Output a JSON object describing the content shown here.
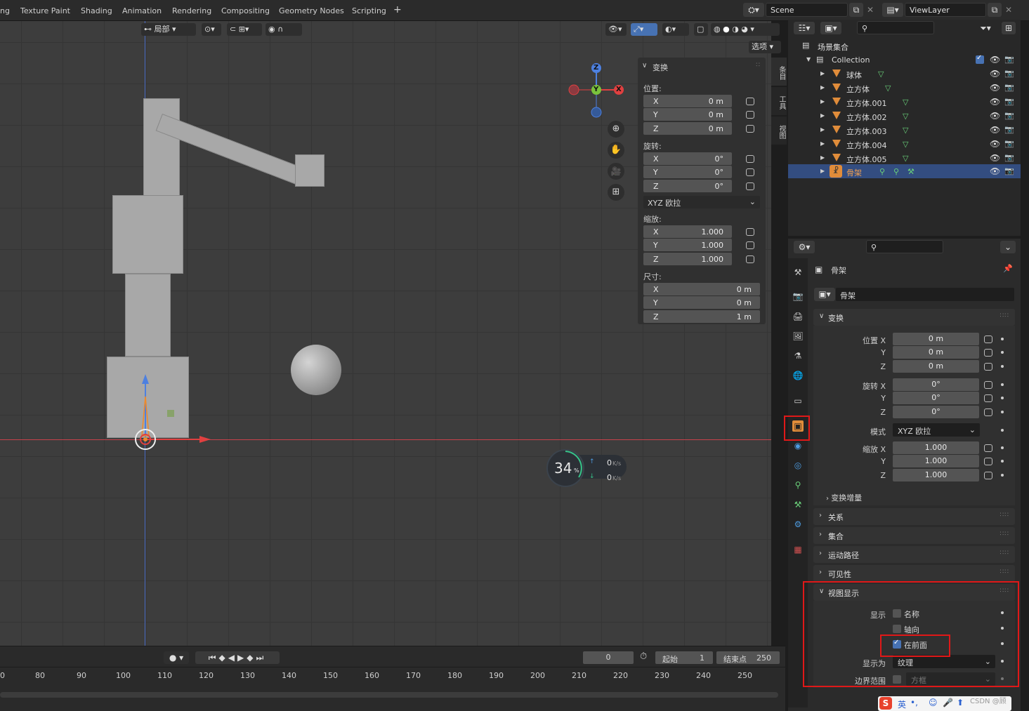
{
  "topbar": {
    "tabs": [
      "ng",
      "Texture Paint",
      "Shading",
      "Animation",
      "Rendering",
      "Compositing",
      "Geometry Nodes",
      "Scripting",
      "+"
    ],
    "scene": "Scene",
    "view_layer": "ViewLayer"
  },
  "viewport": {
    "transform_orientation": "局部",
    "options_label": "选项",
    "gizmo_axes": [
      "Z",
      "Y",
      "X"
    ],
    "side_tabs": [
      "条目",
      "工具",
      "视图"
    ],
    "npanel": {
      "title": "变换",
      "location_label": "位置:",
      "location": [
        {
          "axis": "X",
          "value": "0 m"
        },
        {
          "axis": "Y",
          "value": "0 m"
        },
        {
          "axis": "Z",
          "value": "0 m"
        }
      ],
      "rotation_label": "旋转:",
      "rotation": [
        {
          "axis": "X",
          "value": "0°"
        },
        {
          "axis": "Y",
          "value": "0°"
        },
        {
          "axis": "Z",
          "value": "0°"
        }
      ],
      "rotation_mode": "XYZ 欧拉",
      "scale_label": "缩放:",
      "scale": [
        {
          "axis": "X",
          "value": "1.000"
        },
        {
          "axis": "Y",
          "value": "1.000"
        },
        {
          "axis": "Z",
          "value": "1.000"
        }
      ],
      "dimensions_label": "尺寸:",
      "dimensions": [
        {
          "axis": "X",
          "value": "0 m"
        },
        {
          "axis": "Y",
          "value": "0 m"
        },
        {
          "axis": "Z",
          "value": "1 m"
        }
      ]
    },
    "net_widget": {
      "percent": "34",
      "percent_unit": "%",
      "up": "0",
      "down": "0",
      "unit": "K/s"
    }
  },
  "timeline": {
    "current_frame": "0",
    "start_label": "起始",
    "start": "1",
    "end_label": "结束点",
    "end": "250",
    "ticks": [
      "0",
      "80",
      "90",
      "100",
      "110",
      "120",
      "130",
      "140",
      "150",
      "160",
      "170",
      "180",
      "190",
      "200",
      "210",
      "220",
      "230",
      "240",
      "250"
    ]
  },
  "outliner": {
    "scene_collection": "场景集合",
    "collection": "Collection",
    "items": [
      "球体",
      "立方体",
      "立方体.001",
      "立方体.002",
      "立方体.003",
      "立方体.004",
      "立方体.005",
      "骨架"
    ]
  },
  "properties": {
    "object_name": "骨架",
    "data_name": "骨架",
    "transform": {
      "title": "变换",
      "location_label": "位置 X",
      "location": [
        "0 m",
        "0 m",
        "0 m"
      ],
      "rotation_label": "旋转 X",
      "rotation": [
        "0°",
        "0°",
        "0°"
      ],
      "mode_label": "模式",
      "mode": "XYZ 欧拉",
      "scale_label": "缩放 X",
      "scale": [
        "1.000",
        "1.000",
        "1.000"
      ],
      "axis_y": "Y",
      "axis_z": "Z",
      "delta": "变换增量"
    },
    "collapsed_panels": [
      "关系",
      "集合",
      "运动路径",
      "可见性"
    ],
    "viewport_display": {
      "title": "视图显示",
      "show_label": "显示",
      "name_label": "名称",
      "axes_label": "轴向",
      "in_front_label": "在前面",
      "name": false,
      "axes": false,
      "in_front": true,
      "display_as_label": "显示为",
      "display_as": "纹理",
      "bounds_label": "边界范围",
      "bounds": "方框"
    }
  },
  "taskbar": {
    "ime": "英",
    "watermark": "CSDN @顾"
  }
}
